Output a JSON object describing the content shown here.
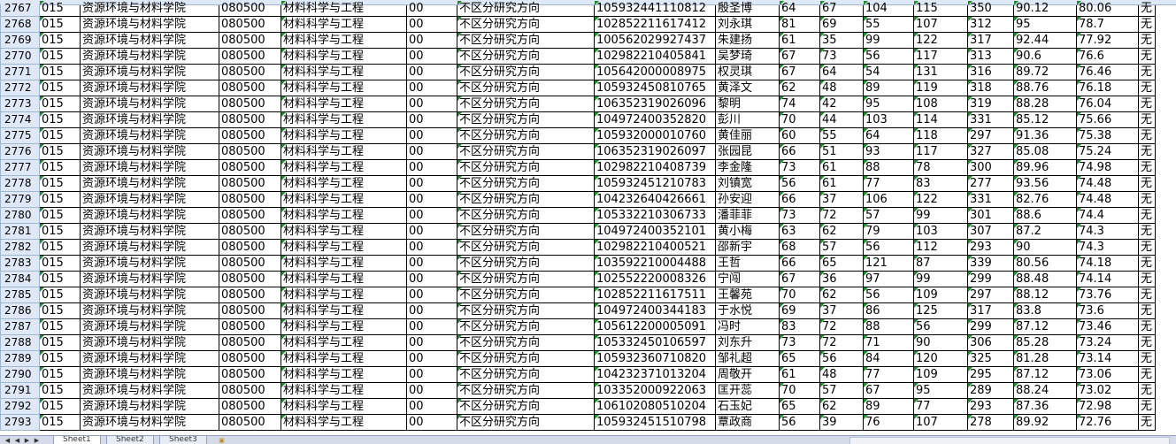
{
  "sheet": {
    "rows": [
      {
        "num": "2767",
        "cells": [
          "015",
          "资源环境与材料学院",
          "080500",
          "材料科学与工程",
          "00",
          "不区分研究方向",
          "105932441110812",
          "殷圣博",
          "64",
          "67",
          "104",
          "115",
          "350",
          "90.12",
          "80.06",
          "无"
        ]
      },
      {
        "num": "2768",
        "cells": [
          "015",
          "资源环境与材料学院",
          "080500",
          "材料科学与工程",
          "00",
          "不区分研究方向",
          "102852211617412",
          "刘永琪",
          "81",
          "69",
          "55",
          "107",
          "312",
          "95",
          "78.7",
          "无"
        ]
      },
      {
        "num": "2769",
        "cells": [
          "015",
          "资源环境与材料学院",
          "080500",
          "材料科学与工程",
          "00",
          "不区分研究方向",
          "100562029927437",
          "朱建扬",
          "61",
          "35",
          "99",
          "122",
          "317",
          "92.44",
          "77.92",
          "无"
        ]
      },
      {
        "num": "2770",
        "cells": [
          "015",
          "资源环境与材料学院",
          "080500",
          "材料科学与工程",
          "00",
          "不区分研究方向",
          "102982210405841",
          "吴梦琦",
          "67",
          "73",
          "56",
          "117",
          "313",
          "90.6",
          "76.6",
          "无"
        ]
      },
      {
        "num": "2771",
        "cells": [
          "015",
          "资源环境与材料学院",
          "080500",
          "材料科学与工程",
          "00",
          "不区分研究方向",
          "105642000008975",
          "权灵琪",
          "67",
          "64",
          "54",
          "131",
          "316",
          "89.72",
          "76.46",
          "无"
        ]
      },
      {
        "num": "2772",
        "cells": [
          "015",
          "资源环境与材料学院",
          "080500",
          "材料科学与工程",
          "00",
          "不区分研究方向",
          "105932450810765",
          "黄泽文",
          "62",
          "48",
          "89",
          "119",
          "318",
          "88.76",
          "76.18",
          "无"
        ]
      },
      {
        "num": "2773",
        "cells": [
          "015",
          "资源环境与材料学院",
          "080500",
          "材料科学与工程",
          "00",
          "不区分研究方向",
          "106352319026096",
          "黎明",
          "74",
          "42",
          "95",
          "108",
          "319",
          "88.28",
          "76.04",
          "无"
        ]
      },
      {
        "num": "2774",
        "cells": [
          "015",
          "资源环境与材料学院",
          "080500",
          "材料科学与工程",
          "00",
          "不区分研究方向",
          "104972400352820",
          "彭川",
          "70",
          "44",
          "103",
          "114",
          "331",
          "85.12",
          "75.66",
          "无"
        ]
      },
      {
        "num": "2775",
        "cells": [
          "015",
          "资源环境与材料学院",
          "080500",
          "材料科学与工程",
          "00",
          "不区分研究方向",
          "105932000010760",
          "黄佳丽",
          "60",
          "55",
          "64",
          "118",
          "297",
          "91.36",
          "75.38",
          "无"
        ]
      },
      {
        "num": "2776",
        "cells": [
          "015",
          "资源环境与材料学院",
          "080500",
          "材料科学与工程",
          "00",
          "不区分研究方向",
          "106352319026097",
          "张园昆",
          "66",
          "51",
          "93",
          "117",
          "327",
          "85.08",
          "75.24",
          "无"
        ]
      },
      {
        "num": "2777",
        "cells": [
          "015",
          "资源环境与材料学院",
          "080500",
          "材料科学与工程",
          "00",
          "不区分研究方向",
          "102982210408739",
          "李金隆",
          "73",
          "61",
          "88",
          "78",
          "300",
          "89.96",
          "74.98",
          "无"
        ]
      },
      {
        "num": "2778",
        "cells": [
          "015",
          "资源环境与材料学院",
          "080500",
          "材料科学与工程",
          "00",
          "不区分研究方向",
          "105932451210783",
          "刘镇宽",
          "56",
          "61",
          "77",
          "83",
          "277",
          "93.56",
          "74.48",
          "无"
        ]
      },
      {
        "num": "2779",
        "cells": [
          "015",
          "资源环境与材料学院",
          "080500",
          "材料科学与工程",
          "00",
          "不区分研究方向",
          "104232640426661",
          "孙安迎",
          "66",
          "37",
          "106",
          "122",
          "331",
          "82.76",
          "74.48",
          "无"
        ]
      },
      {
        "num": "2780",
        "cells": [
          "015",
          "资源环境与材料学院",
          "080500",
          "材料科学与工程",
          "00",
          "不区分研究方向",
          "105332210306733",
          "潘菲菲",
          "73",
          "72",
          "57",
          "99",
          "301",
          "88.6",
          "74.4",
          "无"
        ]
      },
      {
        "num": "2781",
        "cells": [
          "015",
          "资源环境与材料学院",
          "080500",
          "材料科学与工程",
          "00",
          "不区分研究方向",
          "104972400352101",
          "黄小梅",
          "63",
          "62",
          "79",
          "103",
          "307",
          "87.2",
          "74.3",
          "无"
        ]
      },
      {
        "num": "2782",
        "cells": [
          "015",
          "资源环境与材料学院",
          "080500",
          "材料科学与工程",
          "00",
          "不区分研究方向",
          "102982210400521",
          "邵新宇",
          "68",
          "57",
          "56",
          "112",
          "293",
          "90",
          "74.3",
          "无"
        ]
      },
      {
        "num": "2783",
        "cells": [
          "015",
          "资源环境与材料学院",
          "080500",
          "材料科学与工程",
          "00",
          "不区分研究方向",
          "103592210004488",
          "王哲",
          "66",
          "65",
          "121",
          "87",
          "339",
          "80.56",
          "74.18",
          "无"
        ]
      },
      {
        "num": "2784",
        "cells": [
          "015",
          "资源环境与材料学院",
          "080500",
          "材料科学与工程",
          "00",
          "不区分研究方向",
          "102552220008326",
          "宁闯",
          "67",
          "36",
          "97",
          "99",
          "299",
          "88.48",
          "74.14",
          "无"
        ]
      },
      {
        "num": "2785",
        "cells": [
          "015",
          "资源环境与材料学院",
          "080500",
          "材料科学与工程",
          "00",
          "不区分研究方向",
          "102852211617511",
          "王馨苑",
          "70",
          "62",
          "56",
          "109",
          "297",
          "88.12",
          "73.76",
          "无"
        ]
      },
      {
        "num": "2786",
        "cells": [
          "015",
          "资源环境与材料学院",
          "080500",
          "材料科学与工程",
          "00",
          "不区分研究方向",
          "104972400344183",
          "于水悦",
          "69",
          "37",
          "86",
          "125",
          "317",
          "83.8",
          "73.6",
          "无"
        ]
      },
      {
        "num": "2787",
        "cells": [
          "015",
          "资源环境与材料学院",
          "080500",
          "材料科学与工程",
          "00",
          "不区分研究方向",
          "105612200005091",
          "冯时",
          "83",
          "72",
          "88",
          "56",
          "299",
          "87.12",
          "73.46",
          "无"
        ]
      },
      {
        "num": "2788",
        "cells": [
          "015",
          "资源环境与材料学院",
          "080500",
          "材料科学与工程",
          "00",
          "不区分研究方向",
          "105332450106597",
          "刘东升",
          "73",
          "72",
          "71",
          "90",
          "306",
          "85.28",
          "73.24",
          "无"
        ]
      },
      {
        "num": "2789",
        "cells": [
          "015",
          "资源环境与材料学院",
          "080500",
          "材料科学与工程",
          "00",
          "不区分研究方向",
          "105932360710820",
          "邹礼超",
          "65",
          "56",
          "84",
          "120",
          "325",
          "81.28",
          "73.14",
          "无"
        ]
      },
      {
        "num": "2790",
        "cells": [
          "015",
          "资源环境与材料学院",
          "080500",
          "材料科学与工程",
          "00",
          "不区分研究方向",
          "104232371013204",
          "周敬开",
          "61",
          "48",
          "77",
          "109",
          "295",
          "87.12",
          "73.06",
          "无"
        ]
      },
      {
        "num": "2791",
        "cells": [
          "015",
          "资源环境与材料学院",
          "080500",
          "材料科学与工程",
          "00",
          "不区分研究方向",
          "103352000922063",
          "匡开蕊",
          "70",
          "57",
          "67",
          "95",
          "289",
          "88.24",
          "73.02",
          "无"
        ]
      },
      {
        "num": "2792",
        "cells": [
          "015",
          "资源环境与材料学院",
          "080500",
          "材料科学与工程",
          "00",
          "不区分研究方向",
          "106102080510204",
          "石玉妃",
          "65",
          "62",
          "89",
          "77",
          "293",
          "87.36",
          "72.98",
          "无"
        ]
      },
      {
        "num": "2793",
        "cells": [
          "015",
          "资源环境与材料学院",
          "080500",
          "材料科学与工程",
          "00",
          "不区分研究方向",
          "105932451510798",
          "覃政商",
          "56",
          "39",
          "76",
          "107",
          "278",
          "89.92",
          "72.76",
          "无"
        ]
      }
    ]
  },
  "tabs": {
    "sheet1": "Sheet1",
    "sheet2": "Sheet2",
    "sheet3": "Sheet3"
  },
  "colors": {
    "header_bg": "#dfe8f6",
    "grid": "#000000",
    "text_marker": "#1e8b2d"
  }
}
